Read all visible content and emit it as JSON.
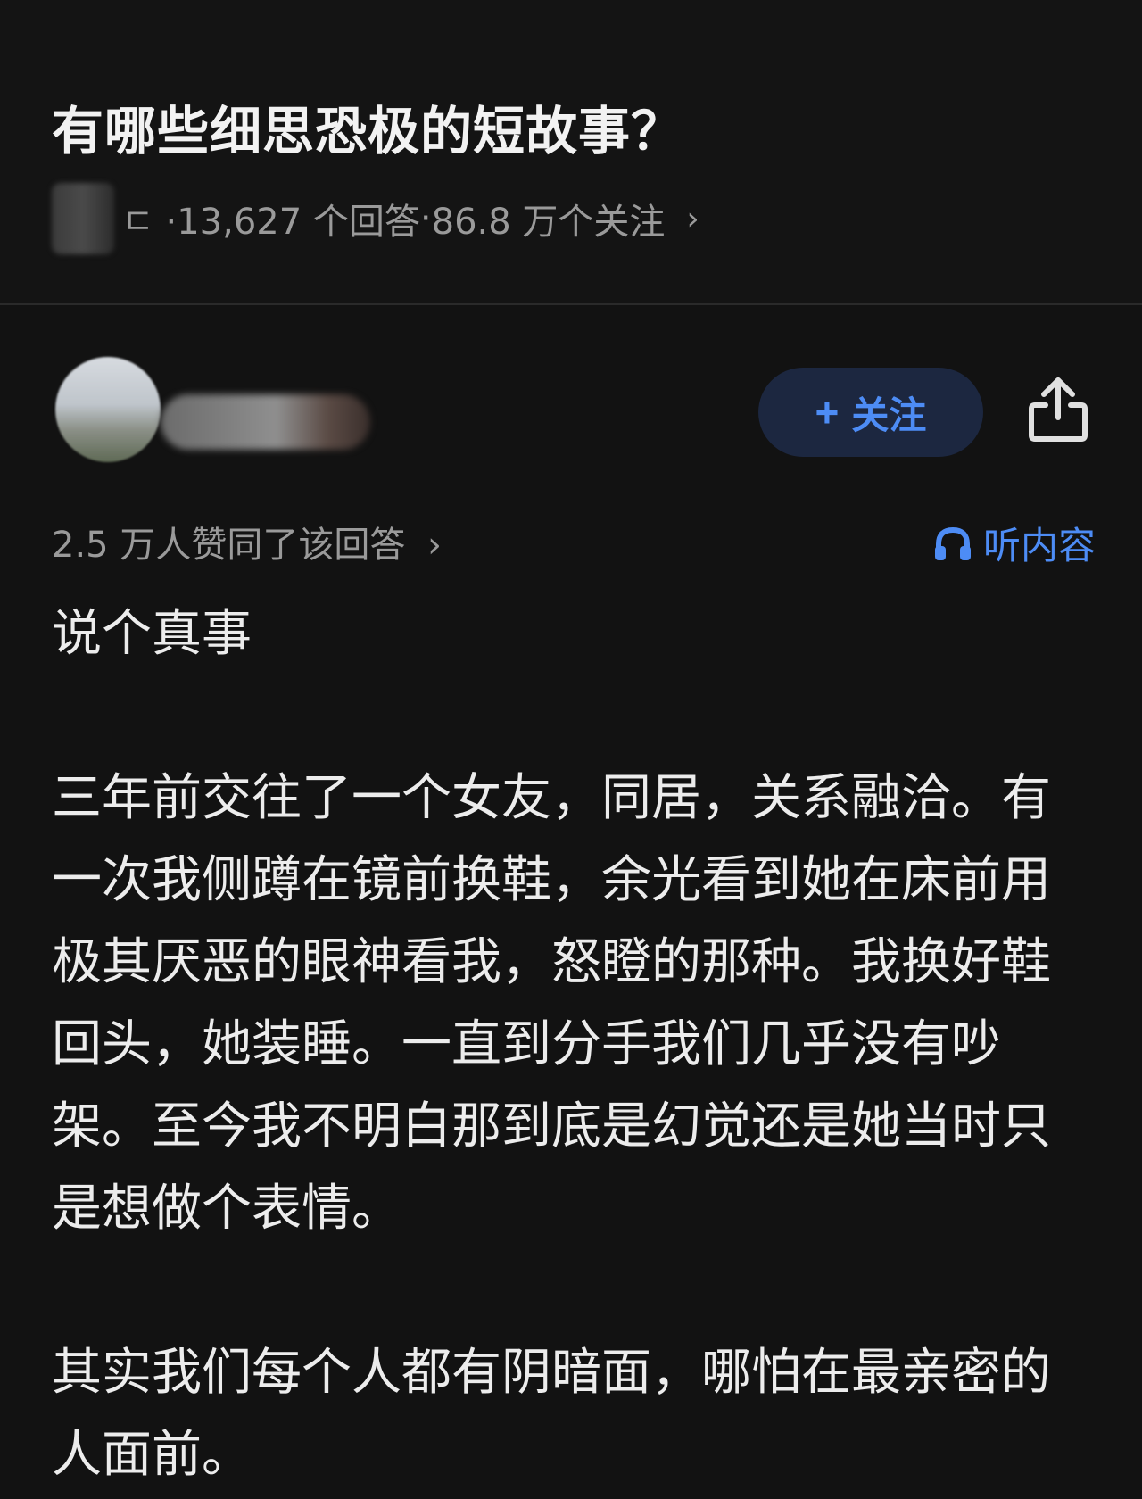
{
  "question": {
    "title": "有哪些细思恐极的短故事？",
    "meta_prefix": "ㄷ · ",
    "answers": "13,627 个回答",
    "sep": " · ",
    "followers": "86.8 万个关注",
    "chevron": "›"
  },
  "author": {
    "follow_label": "关注",
    "follow_icon": "plus-icon",
    "share_icon": "share-icon"
  },
  "answer": {
    "votes_text": "2.5 万人赞同了该回答",
    "votes_chevron": "›",
    "listen_label": "听内容",
    "listen_icon": "headphones-icon",
    "paragraphs": [
      "说个真事",
      "三年前交往了一个女友，同居，关系融洽。有一次我侧蹲在镜前换鞋，余光看到她在床前用极其厌恶的眼神看我，怒瞪的那种。我换好鞋回头，她装睡。一直到分手我们几乎没有吵架。至今我不明白那到底是幻觉还是她当时只是想做个表情。",
      "其实我们每个人都有阴暗面，哪怕在最亲密的人面前。"
    ]
  },
  "colors": {
    "background": "#121212",
    "accent": "#4d8cf5",
    "follow_bg": "#1c2740",
    "muted_text": "#9a9a9a"
  }
}
